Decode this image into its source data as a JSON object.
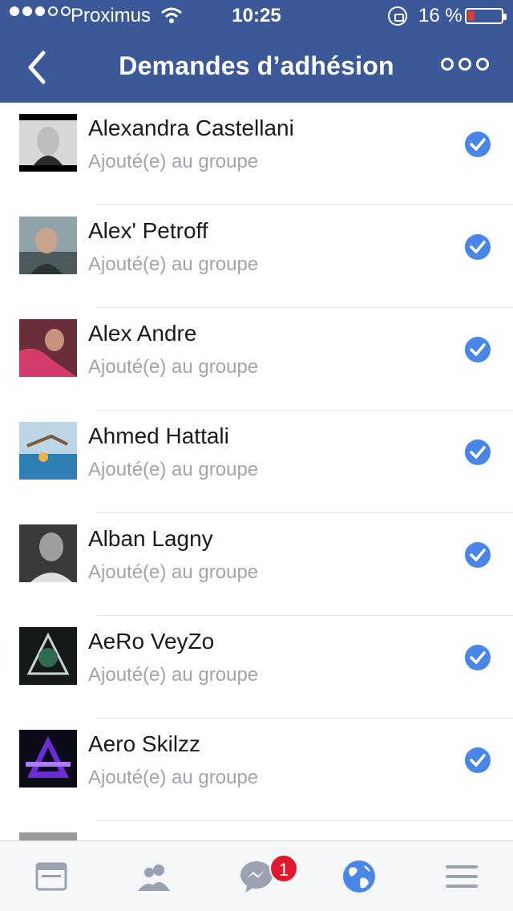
{
  "status_bar": {
    "carrier": "Proximus",
    "time": "10:25",
    "battery_percent": "16 %"
  },
  "nav": {
    "title": "Demandes d’adhésion"
  },
  "members": [
    {
      "name": "Alexandra Castellani",
      "status": "Ajouté(e) au groupe"
    },
    {
      "name": "Alex' Petroff",
      "status": "Ajouté(e) au groupe"
    },
    {
      "name": "Alex Andre",
      "status": "Ajouté(e) au groupe"
    },
    {
      "name": "Ahmed Hattali",
      "status": "Ajouté(e) au groupe"
    },
    {
      "name": "Alban Lagny",
      "status": "Ajouté(e) au groupe"
    },
    {
      "name": "AeRo VeyZo",
      "status": "Ajouté(e) au groupe"
    },
    {
      "name": "Aero Skilzz",
      "status": "Ajouté(e) au groupe"
    }
  ],
  "tabbar": {
    "messenger_badge": "1"
  },
  "colors": {
    "header": "#3b5998",
    "accent": "#4a86e8",
    "badge": "#e0192e"
  }
}
